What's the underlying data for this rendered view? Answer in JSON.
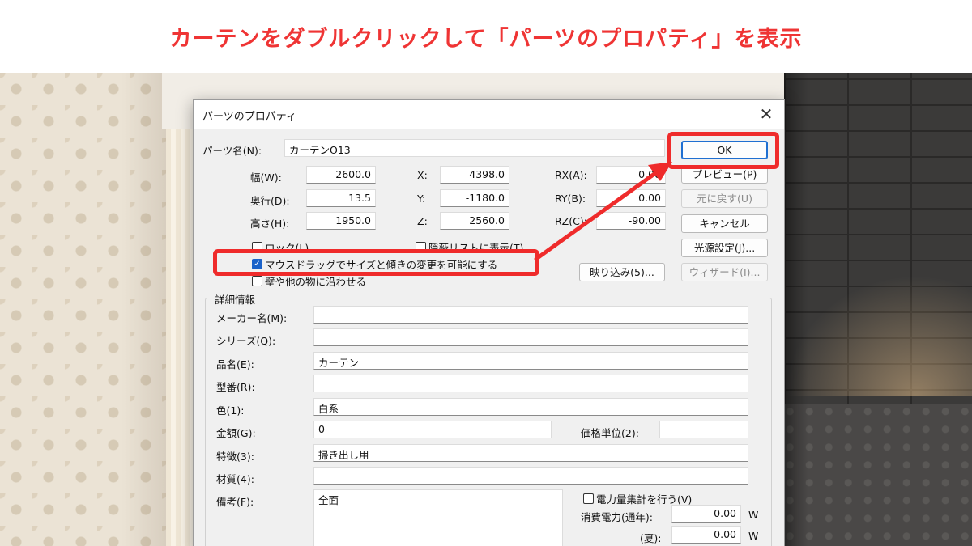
{
  "banner": {
    "text": "カーテンをダブルクリックして「パーツのプロパティ」を表示"
  },
  "dialog": {
    "title": "パーツのプロパティ",
    "close_glyph": "✕",
    "part_name_label": "パーツ名(N):",
    "part_name_value": "カーテンO13",
    "width_label": "幅(W):",
    "width_value": "2600.0",
    "depth_label": "奥行(D):",
    "depth_value": "13.5",
    "height_label": "高さ(H):",
    "height_value": "1950.0",
    "x_label": "X:",
    "x_value": "4398.0",
    "y_label": "Y:",
    "y_value": "-1180.0",
    "z_label": "Z:",
    "z_value": "2560.0",
    "rx_label": "RX(A):",
    "rx_value": "0.00",
    "ry_label": "RY(B):",
    "ry_value": "0.00",
    "rz_label": "RZ(C):",
    "rz_value": "-90.00",
    "buttons": {
      "ok": "OK",
      "preview": "プレビュー(P)",
      "revert": "元に戻す(U)",
      "cancel": "キャンセル",
      "light": "光源設定(J)...",
      "reflection": "映り込み(5)...",
      "wizard": "ウィザード(I)..."
    },
    "checkboxes": {
      "lock": {
        "label": "ロック(L)",
        "checked": false
      },
      "hide_list": {
        "label": "隠蔽リストに表示(T)",
        "checked": false
      },
      "mouse_drag": {
        "label": "マウスドラッグでサイズと傾きの変更を可能にする",
        "checked": true
      },
      "snap_wall": {
        "label": "壁や他の物に沿わせる",
        "checked": false
      },
      "power": {
        "label": "電力量集計を行う(V)",
        "checked": false
      }
    },
    "details": {
      "title": "詳細情報",
      "maker_label": "メーカー名(M):",
      "maker_value": "",
      "series_label": "シリーズ(Q):",
      "series_value": "",
      "product_label": "品名(E):",
      "product_value": "カーテン",
      "model_label": "型番(R):",
      "model_value": "",
      "color_label": "色(1):",
      "color_value": "白系",
      "price_label": "金額(G):",
      "price_value": "0",
      "price_unit_label": "価格単位(2):",
      "price_unit_value": "",
      "feature_label": "特徴(3):",
      "feature_value": "掃き出し用",
      "material_label": "材質(4):",
      "material_value": "",
      "note_label": "備考(F):",
      "note_value": "全面",
      "power_year_label": "消費電力(通年):",
      "power_year_value": "0.00",
      "power_summer_label": "(夏):",
      "power_summer_value": "0.00",
      "unit_w": "W"
    }
  },
  "colors": {
    "highlight": "#ef2b2b",
    "banner_text": "#ef3434",
    "check_blue": "#1a62c9"
  }
}
